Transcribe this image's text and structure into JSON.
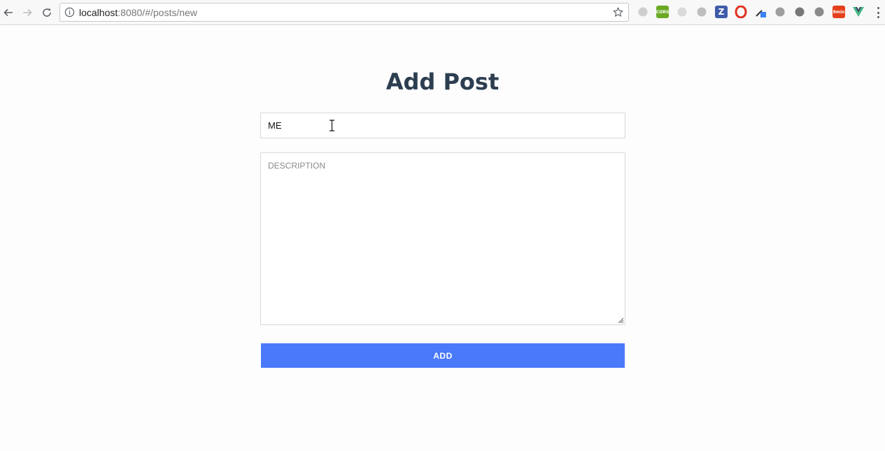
{
  "browser": {
    "url_host": "localhost",
    "url_rest": ":8080/#/posts/new",
    "extensions": [
      {
        "name": "feather-extension-icon",
        "color": "#cfcfcf",
        "text": ""
      },
      {
        "name": "cors-extension-icon",
        "color": "#6aa923",
        "text": "CORS"
      },
      {
        "name": "grid-extension-icon",
        "color": "#d9d9d9",
        "text": ""
      },
      {
        "name": "ghost-extension-icon",
        "color": "#bdbdbd",
        "text": ""
      },
      {
        "name": "zotero-extension-icon",
        "color": "#3f5ba9",
        "text": "Z"
      },
      {
        "name": "opera-extension-icon",
        "color": "#e0301e",
        "text": ""
      },
      {
        "name": "eyedropper-extension-icon",
        "color": "#3b82f6",
        "text": ""
      },
      {
        "name": "pin-extension-icon",
        "color": "#9e9e9e",
        "text": ""
      },
      {
        "name": "camera-extension-icon",
        "color": "#777777",
        "text": ""
      },
      {
        "name": "tomato-extension-icon",
        "color": "#8a8a8a",
        "text": ""
      },
      {
        "name": "8min-extension-icon",
        "color": "#e5401c",
        "text": "8min"
      },
      {
        "name": "vue-devtools-icon",
        "color": "#41b883",
        "text": ""
      }
    ]
  },
  "page": {
    "title": "Add Post",
    "title_field_value": "ME",
    "description_placeholder": "DESCRIPTION",
    "add_button_label": "ADD"
  },
  "colors": {
    "heading": "#2c3e50",
    "button": "#4a79fa"
  }
}
